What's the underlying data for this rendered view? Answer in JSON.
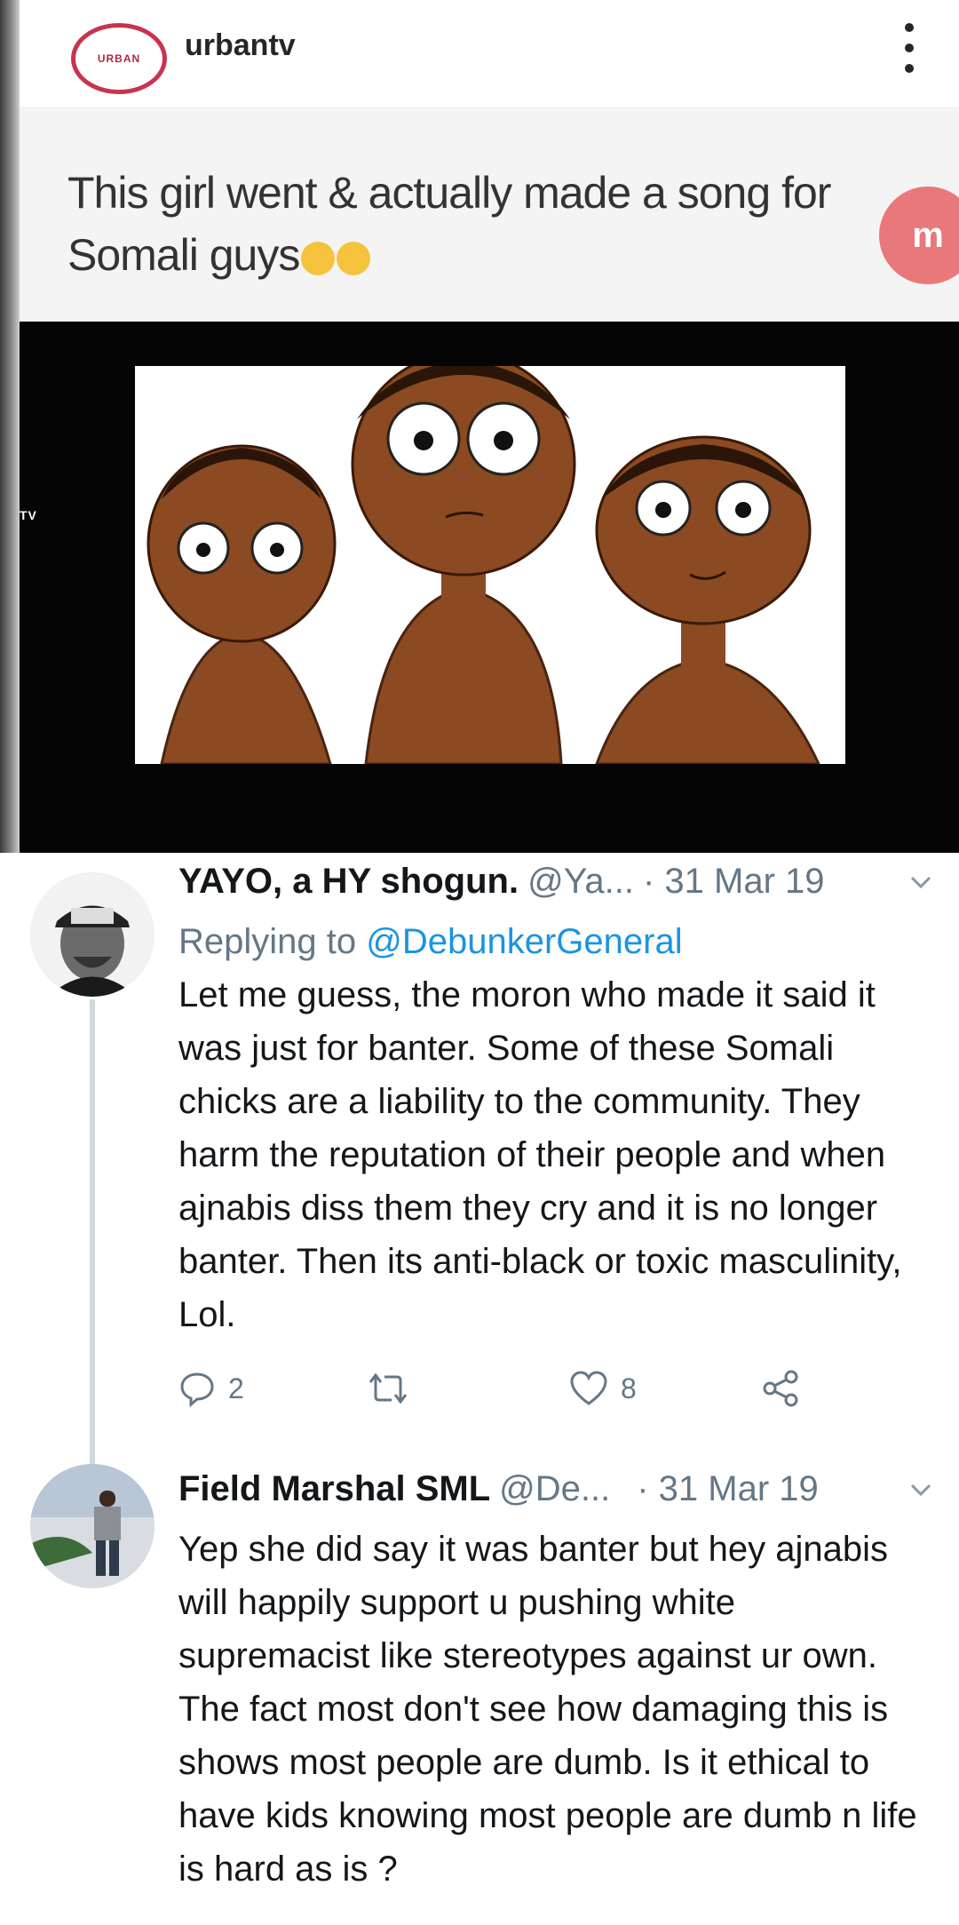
{
  "post": {
    "account_name": "urbantv",
    "avatar_text": "URBAN",
    "caption": "This girl went & actually made a song for Somali guys",
    "watermark_text": "m",
    "video_label": "TV"
  },
  "tweets": [
    {
      "name": "YAYO, a HY shogun.",
      "handle": "@Ya...",
      "date": "· 31 Mar 19",
      "replying_prefix": "Replying to ",
      "replying_to": "@DebunkerGeneral",
      "text": "Let me guess, the moron who made it said it was just for banter. Some of these Somali chicks are a liability to the community. They harm the reputation of their people and when ajnabis diss them they cry and it is no longer banter. Then its anti-black or toxic masculinity, Lol.",
      "reply_count": "2",
      "like_count": "8"
    },
    {
      "name": "Field Marshal SML",
      "handle": "@De...",
      "date": "· 31 Mar 19",
      "text": "Yep she did say it was banter but hey ajnabis will happily support u pushing white supremacist like stereotypes against ur own. The fact most don't see how damaging this is shows most people are dumb. Is it ethical to have kids knowing most people are dumb n life is hard as is ?"
    }
  ],
  "colors": {
    "text": "#14171a",
    "secondary": "#657786",
    "link": "#1b95e0",
    "thread_line": "#cfd9de"
  },
  "icons": [
    "more-vertical-icon",
    "chevron-down-icon",
    "reply-icon",
    "retweet-icon",
    "like-icon",
    "share-icon"
  ]
}
